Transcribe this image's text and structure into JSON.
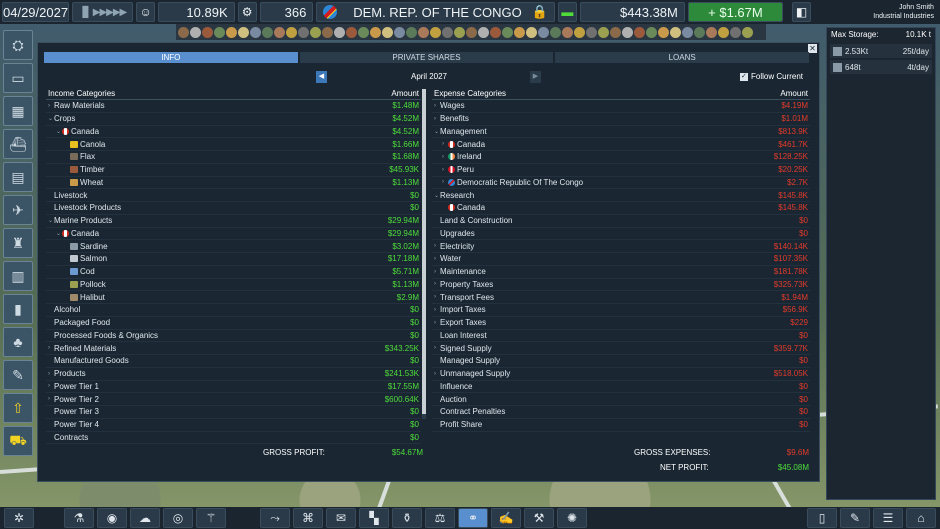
{
  "topbar": {
    "date": "04/29/2027",
    "speed_controls": "▐▌ ▶▶▶▶▶",
    "population_value": "10.89K",
    "workers_value": "366",
    "country_name": "DEM. REP. OF THE CONGO",
    "money": "$443.38M",
    "profit": "+ $1.67M",
    "user_name": "John Smith",
    "company_name": "Industrial Industries"
  },
  "panel": {
    "tabs": [
      "INFO",
      "PRIVATE SHARES",
      "LOANS"
    ],
    "month": "April 2027",
    "follow_current_label": "Follow Current",
    "follow_current_check": "✓",
    "income": {
      "header_category": "Income Categories",
      "header_amount": "Amount",
      "rows": [
        {
          "arrow": "›",
          "indent": 0,
          "label": "Raw Materials",
          "value": "$1.48M"
        },
        {
          "arrow": "⌄",
          "indent": 0,
          "label": "Crops",
          "value": "$4.52M"
        },
        {
          "arrow": "⌄",
          "indent": 1,
          "flag": "canada",
          "label": "Canada",
          "value": "$4.52M"
        },
        {
          "arrow": "",
          "indent": 2,
          "icon": "canola",
          "label": "Canola",
          "value": "$1.66M"
        },
        {
          "arrow": "",
          "indent": 2,
          "icon": "flax",
          "label": "Flax",
          "value": "$1.68M"
        },
        {
          "arrow": "",
          "indent": 2,
          "icon": "timber",
          "label": "Timber",
          "value": "$45.93K"
        },
        {
          "arrow": "",
          "indent": 2,
          "icon": "wheat",
          "label": "Wheat",
          "value": "$1.13M"
        },
        {
          "arrow": "",
          "indent": 0,
          "label": "Livestock",
          "value": "$0"
        },
        {
          "arrow": "",
          "indent": 0,
          "label": "Livestock Products",
          "value": "$0"
        },
        {
          "arrow": "⌄",
          "indent": 0,
          "label": "Marine Products",
          "value": "$29.94M"
        },
        {
          "arrow": "⌄",
          "indent": 1,
          "flag": "canada",
          "label": "Canada",
          "value": "$29.94M"
        },
        {
          "arrow": "",
          "indent": 2,
          "icon": "sardine",
          "label": "Sardine",
          "value": "$3.02M"
        },
        {
          "arrow": "",
          "indent": 2,
          "icon": "salmon",
          "label": "Salmon",
          "value": "$17.18M"
        },
        {
          "arrow": "",
          "indent": 2,
          "icon": "cod",
          "label": "Cod",
          "value": "$5.71M"
        },
        {
          "arrow": "",
          "indent": 2,
          "icon": "pollock",
          "label": "Pollock",
          "value": "$1.13M"
        },
        {
          "arrow": "",
          "indent": 2,
          "icon": "halibut",
          "label": "Halibut",
          "value": "$2.9M"
        },
        {
          "arrow": "",
          "indent": 0,
          "label": "Alcohol",
          "value": "$0"
        },
        {
          "arrow": "",
          "indent": 0,
          "label": "Packaged Food",
          "value": "$0"
        },
        {
          "arrow": "",
          "indent": 0,
          "label": "Processed Foods & Organics",
          "value": "$0"
        },
        {
          "arrow": "›",
          "indent": 0,
          "label": "Refined Materials",
          "value": "$343.25K"
        },
        {
          "arrow": "",
          "indent": 0,
          "label": "Manufactured Goods",
          "value": "$0"
        },
        {
          "arrow": "›",
          "indent": 0,
          "label": "Products",
          "value": "$241.53K"
        },
        {
          "arrow": "›",
          "indent": 0,
          "label": "Power Tier 1",
          "value": "$17.55M"
        },
        {
          "arrow": "›",
          "indent": 0,
          "label": "Power Tier 2",
          "value": "$600.64K"
        },
        {
          "arrow": "",
          "indent": 0,
          "label": "Power Tier 3",
          "value": "$0"
        },
        {
          "arrow": "",
          "indent": 0,
          "label": "Power Tier 4",
          "value": "$0"
        },
        {
          "arrow": "",
          "indent": 0,
          "label": "Contracts",
          "value": "$0"
        }
      ]
    },
    "expense": {
      "header_category": "Expense Categories",
      "header_amount": "Amount",
      "rows": [
        {
          "arrow": "›",
          "indent": 0,
          "label": "Wages",
          "value": "$4.19M"
        },
        {
          "arrow": "›",
          "indent": 0,
          "label": "Benefits",
          "value": "$1.01M"
        },
        {
          "arrow": "⌄",
          "indent": 0,
          "label": "Management",
          "value": "$813.9K"
        },
        {
          "arrow": "›",
          "indent": 1,
          "flag": "canada",
          "label": "Canada",
          "value": "$461.7K"
        },
        {
          "arrow": "›",
          "indent": 1,
          "flag": "ireland",
          "label": "Ireland",
          "value": "$128.25K"
        },
        {
          "arrow": "›",
          "indent": 1,
          "flag": "peru",
          "label": "Peru",
          "value": "$20.25K"
        },
        {
          "arrow": "›",
          "indent": 1,
          "flag": "drc",
          "label": "Democratic Republic Of The Congo",
          "value": "$2.7K"
        },
        {
          "arrow": "⌄",
          "indent": 0,
          "label": "Research",
          "value": "$145.8K"
        },
        {
          "arrow": "",
          "indent": 1,
          "flag": "canada",
          "label": "Canada",
          "value": "$145.8K"
        },
        {
          "arrow": "",
          "indent": 0,
          "label": "Land & Construction",
          "value": "$0"
        },
        {
          "arrow": "",
          "indent": 0,
          "label": "Upgrades",
          "value": "$0"
        },
        {
          "arrow": "›",
          "indent": 0,
          "label": "Electricity",
          "value": "$140.14K"
        },
        {
          "arrow": "›",
          "indent": 0,
          "label": "Water",
          "value": "$107.35K"
        },
        {
          "arrow": "›",
          "indent": 0,
          "label": "Maintenance",
          "value": "$181.78K"
        },
        {
          "arrow": "›",
          "indent": 0,
          "label": "Property Taxes",
          "value": "$325.73K"
        },
        {
          "arrow": "›",
          "indent": 0,
          "label": "Transport Fees",
          "value": "$1.94M"
        },
        {
          "arrow": "›",
          "indent": 0,
          "label": "Import Taxes",
          "value": "$56.9K"
        },
        {
          "arrow": "›",
          "indent": 0,
          "label": "Export Taxes",
          "value": "$229"
        },
        {
          "arrow": "",
          "indent": 0,
          "label": "Loan Interest",
          "value": "$0"
        },
        {
          "arrow": "›",
          "indent": 0,
          "label": "Signed Supply",
          "value": "$359.77K"
        },
        {
          "arrow": "",
          "indent": 0,
          "label": "Managed Supply",
          "value": "$0"
        },
        {
          "arrow": "›",
          "indent": 0,
          "label": "Unmanaged Supply",
          "value": "$518.05K"
        },
        {
          "arrow": "",
          "indent": 0,
          "label": "Influence",
          "value": "$0"
        },
        {
          "arrow": "",
          "indent": 0,
          "label": "Auction",
          "value": "$0"
        },
        {
          "arrow": "",
          "indent": 0,
          "label": "Contract Penalties",
          "value": "$0"
        },
        {
          "arrow": "",
          "indent": 0,
          "label": "Profit Share",
          "value": "$0"
        }
      ]
    },
    "totals": {
      "gross_profit_label": "GROSS PROFIT:",
      "gross_profit_value": "$54.67M",
      "gross_expenses_label": "GROSS EXPENSES:",
      "gross_expenses_value": "$9.6M",
      "net_profit_label": "NET PROFIT:",
      "net_profit_value": "$45.08M"
    }
  },
  "storage": {
    "title": "Max Storage:",
    "max_value": "10.1K t",
    "rows": [
      {
        "amount": "2.53Kt",
        "rate": "25t/day"
      },
      {
        "amount": "648t",
        "rate": "4t/day"
      }
    ]
  },
  "colors": {
    "accent": "#5a8fcf",
    "income_green": "#4fdc3a",
    "expense_red": "#e23a2a",
    "profit_bar": "#2c8a3a"
  }
}
